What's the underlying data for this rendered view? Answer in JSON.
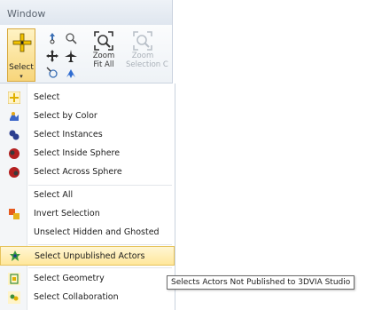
{
  "ribbon": {
    "tab_label": "Window",
    "select_button": {
      "label": "Select",
      "arrow": "▾"
    },
    "zoom_fit_all": {
      "line1": "Zoom",
      "line2": "Fit All"
    },
    "zoom_selection": {
      "line1": "Zoom",
      "line2": "Selection C"
    }
  },
  "menu": {
    "items": [
      {
        "label": "Select",
        "icon": "select-cross-icon"
      },
      {
        "label": "Select by Color",
        "icon": "color-select-icon"
      },
      {
        "label": "Select Instances",
        "icon": "instances-icon"
      },
      {
        "label": "Select Inside Sphere",
        "icon": "inside-sphere-icon"
      },
      {
        "label": "Select Across Sphere",
        "icon": "across-sphere-icon"
      },
      {
        "label": "Select All",
        "icon": ""
      },
      {
        "label": "Invert Selection",
        "icon": "invert-selection-icon"
      },
      {
        "label": "Unselect Hidden and Ghosted",
        "icon": ""
      },
      {
        "label": "Select Unpublished Actors",
        "icon": "unpublished-actors-icon"
      },
      {
        "label": "Select Geometry",
        "icon": "geometry-icon"
      },
      {
        "label": "Select Collaboration",
        "icon": "collaboration-icon"
      }
    ],
    "highlighted_index": 8
  },
  "tooltip": {
    "text": "Selects Actors Not Published to 3DVIA Studio"
  },
  "colors": {
    "highlight": "#ffe79b",
    "highlight_border": "#e6c35c",
    "accent_yellow": "#f2c200"
  }
}
